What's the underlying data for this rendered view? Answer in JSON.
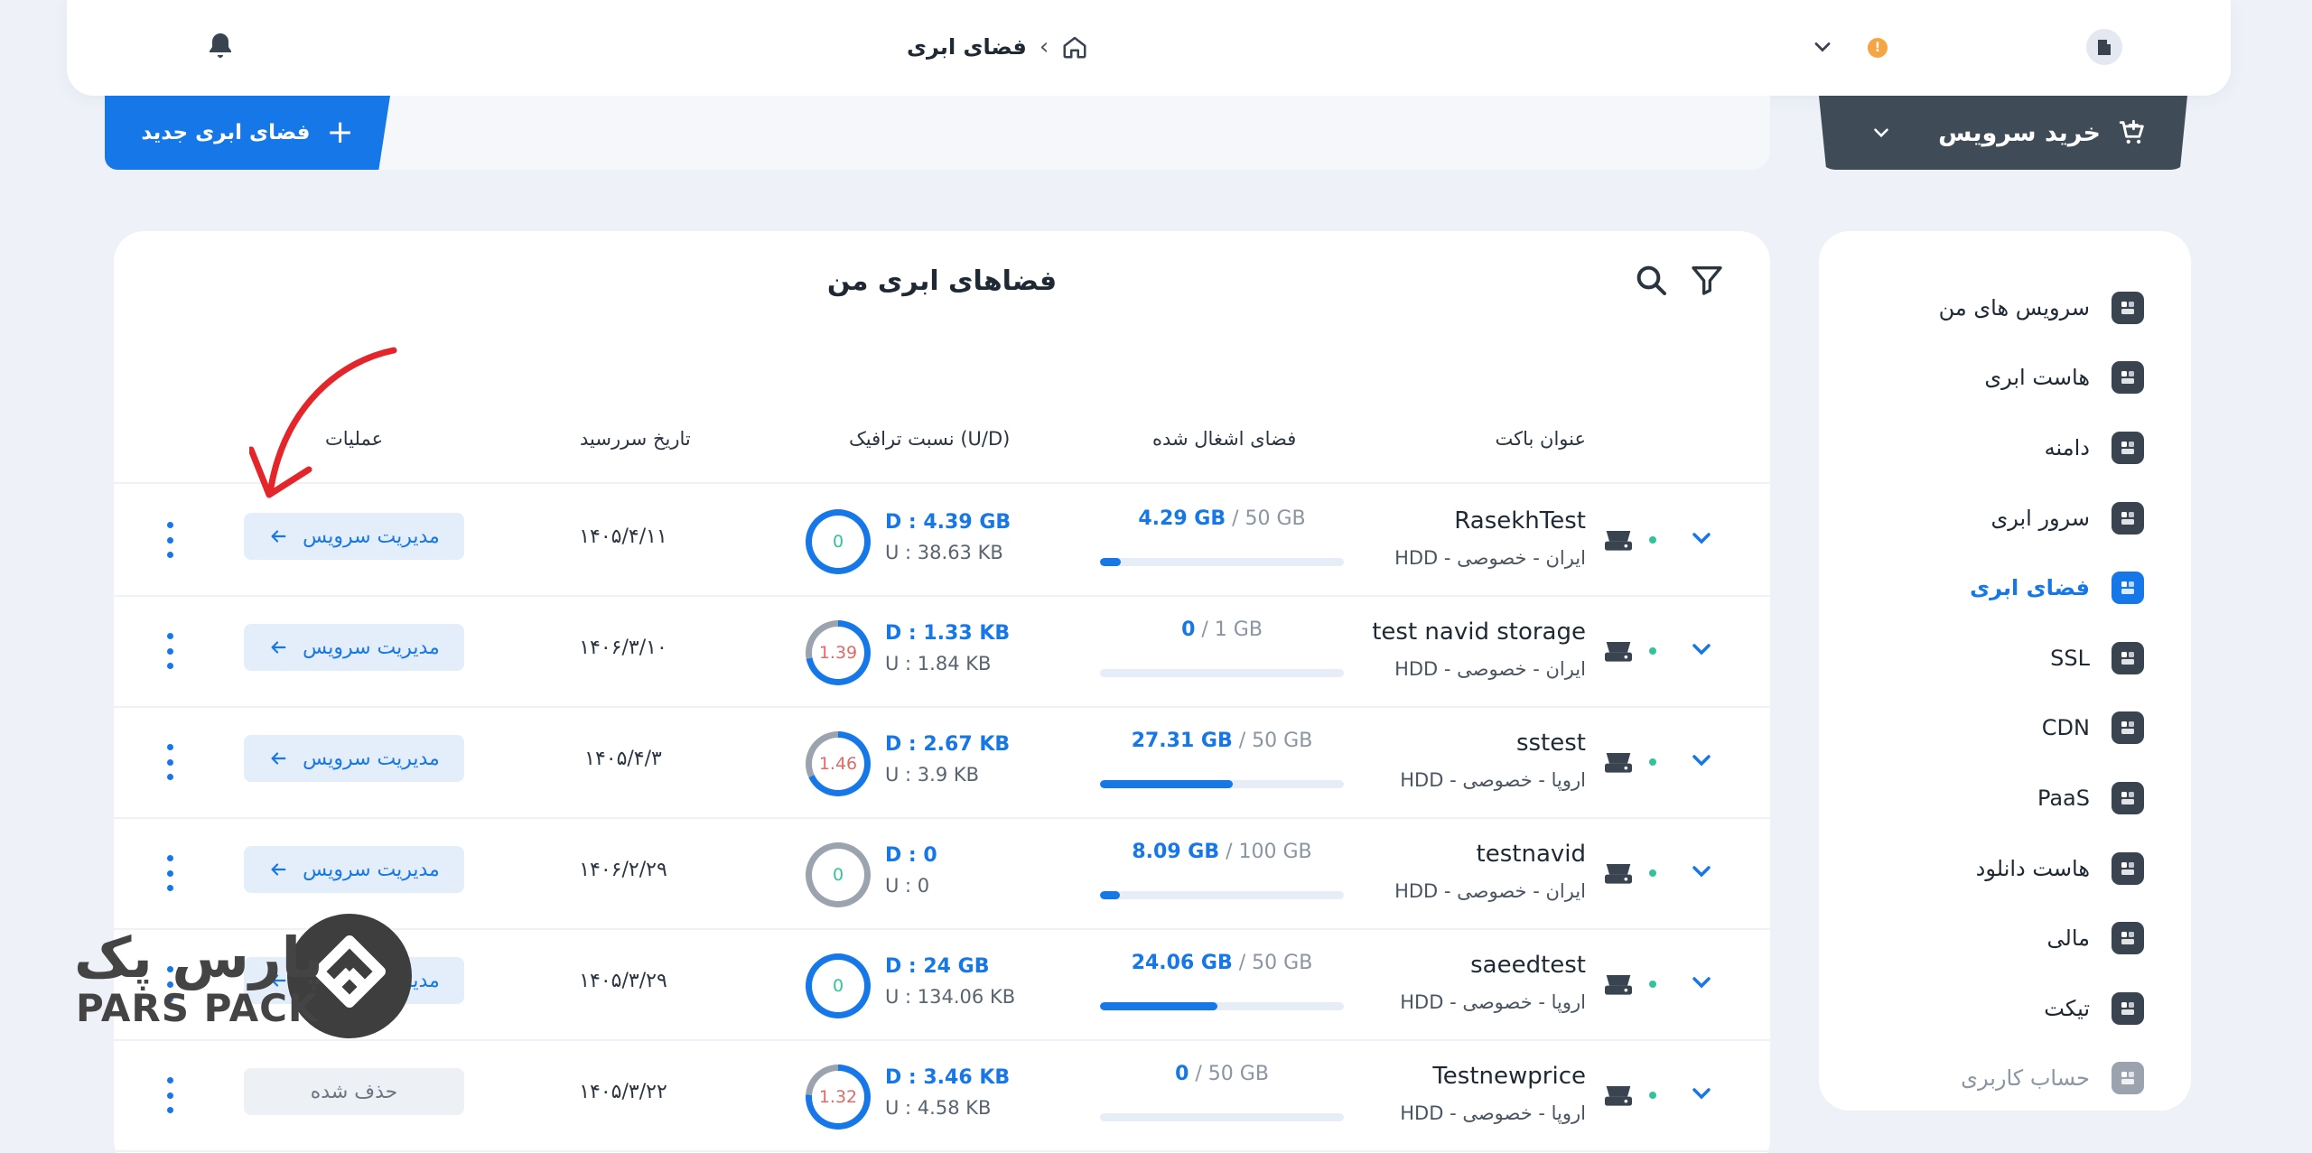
{
  "header": {
    "breadcrumb_current": "فضای ابری",
    "breadcrumb_sep": "›",
    "alert_badge": "!"
  },
  "actions": {
    "new_cloud_space": "فضای ابری جدید",
    "new_icon": "plus-icon",
    "buy_service": "خرید سرویس"
  },
  "sidebar": {
    "items": [
      {
        "label": "سرویس های من",
        "icon": "dashboard-icon",
        "state": "normal"
      },
      {
        "label": "هاست ابری",
        "icon": "cloud-host-icon",
        "state": "normal"
      },
      {
        "label": "دامنه",
        "icon": "domain-icon",
        "state": "normal"
      },
      {
        "label": "سرور ابری",
        "icon": "server-icon",
        "state": "normal"
      },
      {
        "label": "فضای ابری",
        "icon": "cloud-storage-icon",
        "state": "active"
      },
      {
        "label": "SSL",
        "icon": "ssl-lock-icon",
        "state": "normal"
      },
      {
        "label": "CDN",
        "icon": "cdn-globe-icon",
        "state": "normal"
      },
      {
        "label": "PaaS",
        "icon": "paas-box-icon",
        "state": "normal"
      },
      {
        "label": "هاست دانلود",
        "icon": "download-host-icon",
        "state": "normal"
      },
      {
        "label": "مالی",
        "icon": "finance-icon",
        "state": "normal"
      },
      {
        "label": "تیکت",
        "icon": "headset-icon",
        "state": "normal"
      },
      {
        "label": "حساب کاربری",
        "icon": "user-account-icon",
        "state": "muted"
      }
    ]
  },
  "table": {
    "title": "فضاهای ابری من",
    "columns": {
      "bucket": "عنوان باکت",
      "usage": "فضای اشغال شده",
      "traffic": "نسبت ترافیک (U/D)",
      "expiry": "تاریخ سررسید",
      "ops": "عملیات"
    },
    "rows": [
      {
        "name": "RasekhTest",
        "sub": "ایران - خصوصی - HDD",
        "used": "4.29 GB",
        "total": "/ 50 GB",
        "usage_fraction": 0.086,
        "ratio": "0",
        "ratio_color": "#33c29a",
        "ring_fraction": 1.0,
        "ring_color": "#1677e8",
        "d": "D : 4.39 GB",
        "u": "U : 38.63 KB",
        "date": "۱۴۰۵/۴/۱۱",
        "action": "مدیریت سرویس",
        "deleted": false
      },
      {
        "name": "test navid storage",
        "sub": "ایران - خصوصی - HDD",
        "used": "0",
        "total": "/ 1 GB",
        "usage_fraction": 0.0,
        "ratio": "1.39",
        "ratio_color": "#e06a6a",
        "ring_fraction": 0.72,
        "ring_color": "#1677e8",
        "d": "D : 1.33 KB",
        "u": "U : 1.84 KB",
        "date": "۱۴۰۶/۳/۱۰",
        "action": "مدیریت سرویس",
        "deleted": false
      },
      {
        "name": "sstest",
        "sub": "اروپا - خصوصی - HDD",
        "used": "27.31 GB",
        "total": "/ 50 GB",
        "usage_fraction": 0.546,
        "ratio": "1.46",
        "ratio_color": "#e06a6a",
        "ring_fraction": 0.68,
        "ring_color": "#1677e8",
        "d": "D : 2.67 KB",
        "u": "U : 3.9 KB",
        "date": "۱۴۰۵/۴/۳",
        "action": "مدیریت سرویس",
        "deleted": false
      },
      {
        "name": "testnavid",
        "sub": "ایران - خصوصی - HDD",
        "used": "8.09 GB",
        "total": "/ 100 GB",
        "usage_fraction": 0.081,
        "ratio": "0",
        "ratio_color": "#33c29a",
        "ring_fraction": 0.0,
        "ring_color": "#1677e8",
        "d": "D : 0",
        "u": "U : 0",
        "date": "۱۴۰۶/۲/۲۹",
        "action": "مدیریت سرویس",
        "deleted": false
      },
      {
        "name": "saeedtest",
        "sub": "اروپا - خصوصی - HDD",
        "used": "24.06 GB",
        "total": "/ 50 GB",
        "usage_fraction": 0.481,
        "ratio": "0",
        "ratio_color": "#33c29a",
        "ring_fraction": 1.0,
        "ring_color": "#1677e8",
        "d": "D : 24 GB",
        "u": "U : 134.06 KB",
        "date": "۱۴۰۵/۳/۲۹",
        "action": "مدیریت سرویس",
        "deleted": false
      },
      {
        "name": "Testnewprice",
        "sub": "اروپا - خصوصی - HDD",
        "used": "0",
        "total": "/ 50 GB",
        "usage_fraction": 0.0,
        "ratio": "1.32",
        "ratio_color": "#e06a6a",
        "ring_fraction": 0.76,
        "ring_color": "#1677e8",
        "d": "D : 3.46 KB",
        "u": "U : 4.58 KB",
        "date": "۱۴۰۵/۳/۲۲",
        "action": "حذف شده",
        "deleted": true
      }
    ]
  },
  "watermark": {
    "persian": "پارس پک",
    "latin": "PARS PACK"
  }
}
